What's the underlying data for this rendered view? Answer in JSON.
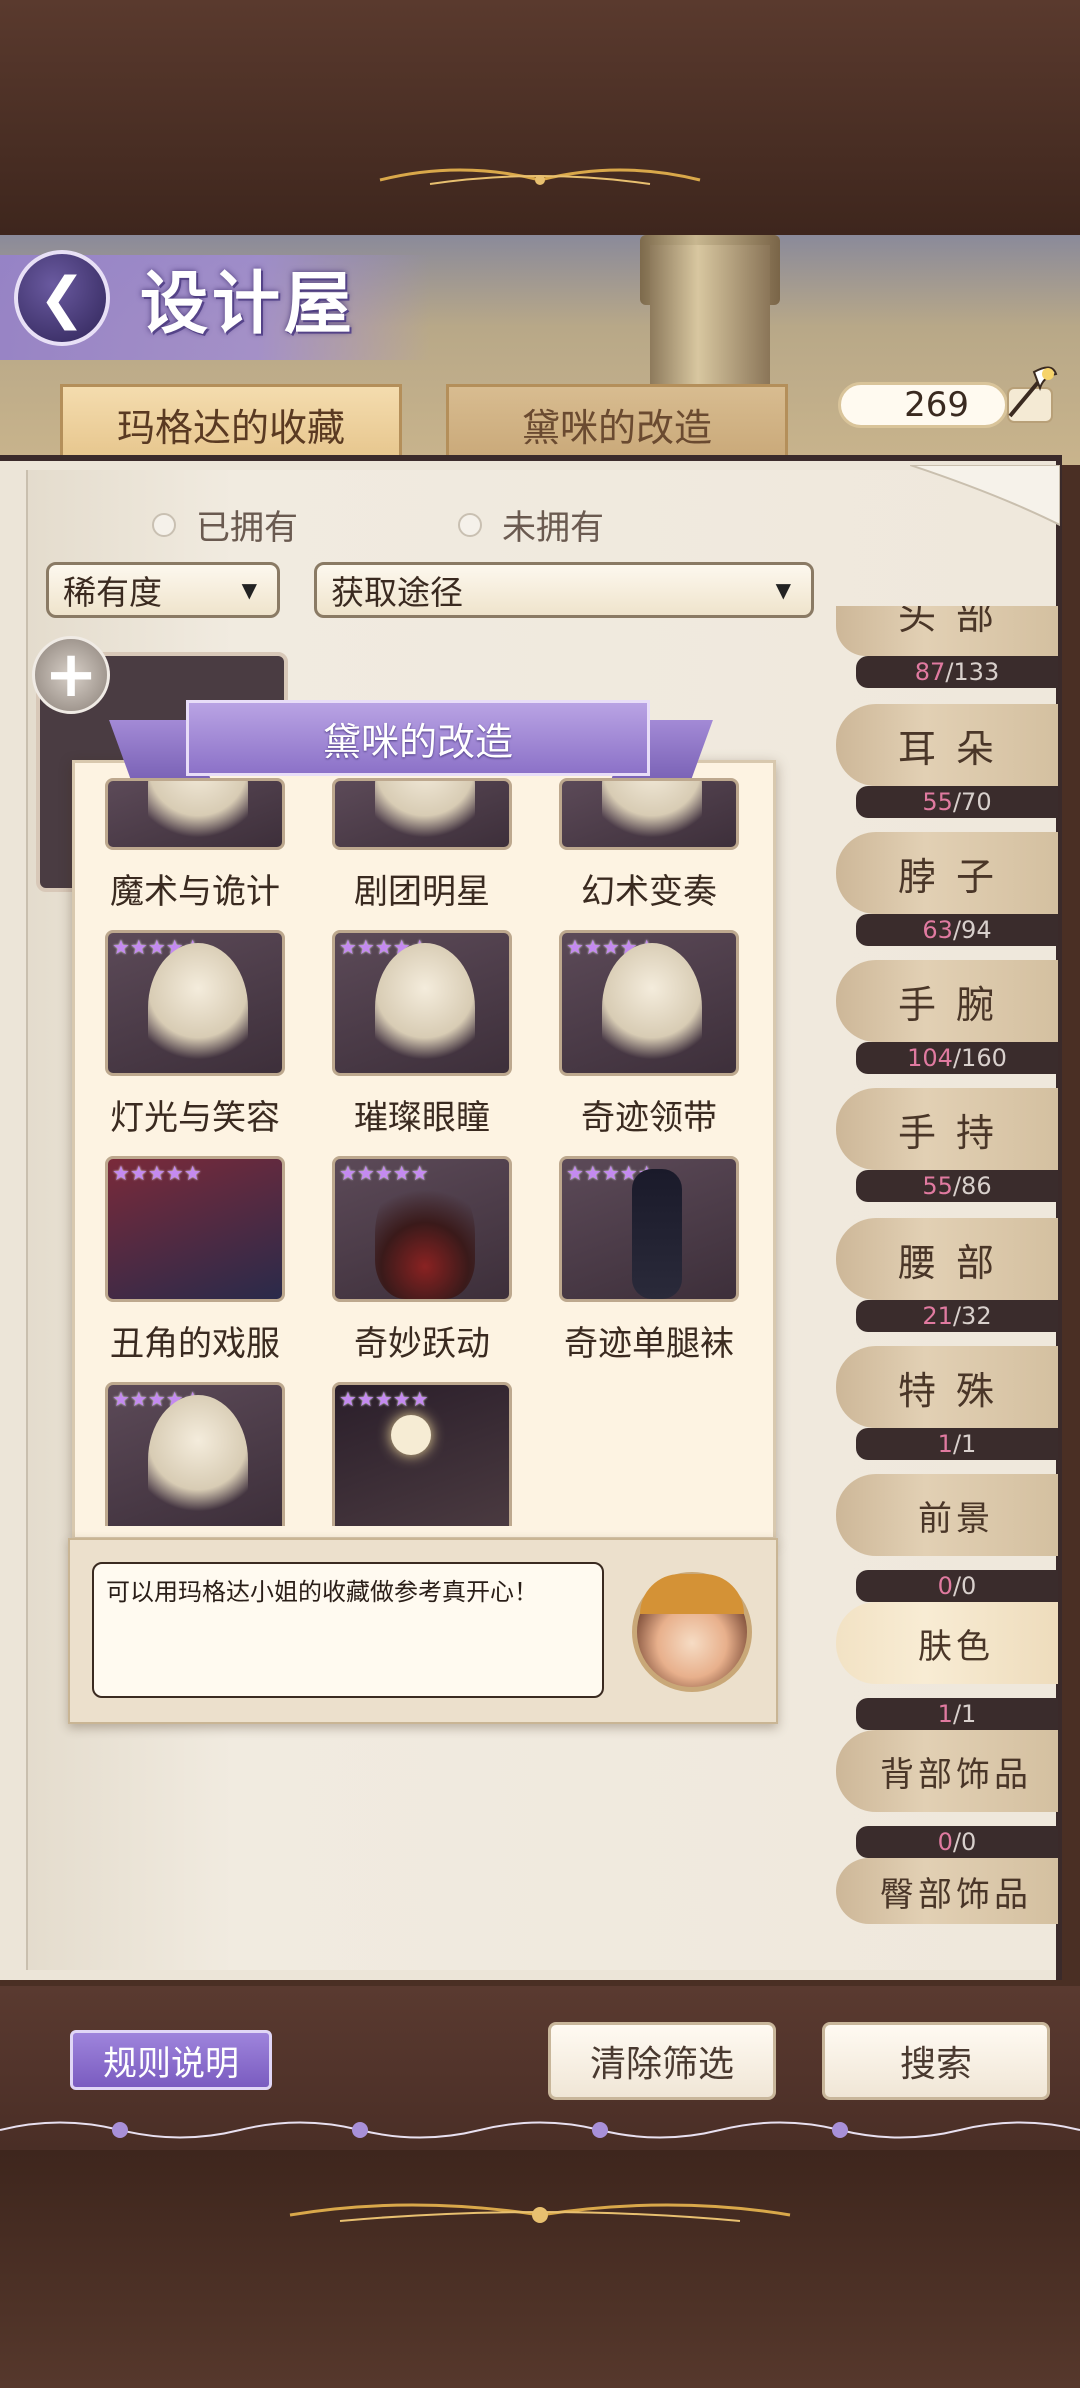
{
  "header": {
    "title": "设计屋",
    "back_icon": "back-arrow-icon",
    "currency_value": "269",
    "currency_icon": "quill-icon"
  },
  "tabs": [
    {
      "label": "玛格达的收藏",
      "active": true
    },
    {
      "label": "黛咪的改造",
      "active": false
    }
  ],
  "filters": {
    "owned_label": "已拥有",
    "not_owned_label": "未拥有",
    "rarity_dropdown": "稀有度",
    "source_dropdown": "获取途径"
  },
  "categories": [
    {
      "label": "头部",
      "have": "87",
      "total": "133"
    },
    {
      "label": "耳朵",
      "have": "55",
      "total": "70"
    },
    {
      "label": "脖子",
      "have": "63",
      "total": "94"
    },
    {
      "label": "手腕",
      "have": "104",
      "total": "160"
    },
    {
      "label": "手持",
      "have": "55",
      "total": "86"
    },
    {
      "label": "腰部",
      "have": "21",
      "total": "32"
    },
    {
      "label": "特殊",
      "have": "1",
      "total": "1"
    },
    {
      "label": "前景",
      "have": "0",
      "total": "0"
    },
    {
      "label": "肤色",
      "have": "1",
      "total": "1"
    },
    {
      "label": "背部饰品",
      "have": "0",
      "total": "0"
    },
    {
      "label": "臀部饰品",
      "have": "",
      "total": ""
    }
  ],
  "popup": {
    "title": "黛咪的改造",
    "items": [
      {
        "name": "魔术与诡计"
      },
      {
        "name": "剧团明星"
      },
      {
        "name": "幻术变奏"
      },
      {
        "name": "灯光与笑容"
      },
      {
        "name": "璀璨眼瞳"
      },
      {
        "name": "奇迹领带"
      },
      {
        "name": "丑角的戏服"
      },
      {
        "name": "奇妙跃动"
      },
      {
        "name": "奇迹单腿袜"
      },
      {
        "name": ""
      },
      {
        "name": ""
      }
    ],
    "dialog": "可以用玛格达小姐的收藏做参考真开心！"
  },
  "footer": {
    "rules_label": "规则说明",
    "clear_label": "清除筛选",
    "search_label": "搜索"
  },
  "colors": {
    "accent_purple": "#8c72c8",
    "wood_dark": "#4a2e26",
    "paper": "#fdf3e2",
    "count_highlight": "#e07aa0"
  }
}
